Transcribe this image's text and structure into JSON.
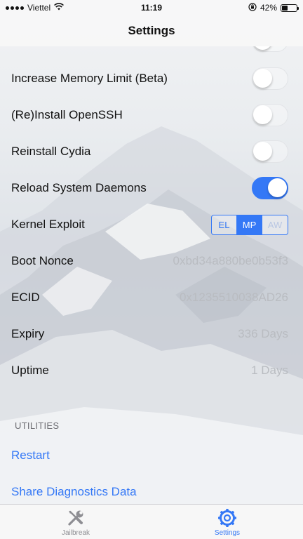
{
  "status_bar": {
    "carrier": "Viettel",
    "time": "11:19",
    "battery_percent": "42%",
    "battery_level": 0.42
  },
  "nav": {
    "title": "Settings"
  },
  "settings": {
    "rows": [
      {
        "label": "Increase Memory Limit (Beta)",
        "type": "toggle",
        "on": false
      },
      {
        "label": "(Re)Install OpenSSH",
        "type": "toggle",
        "on": false
      },
      {
        "label": "Reinstall Cydia",
        "type": "toggle",
        "on": false
      },
      {
        "label": "Reload System Daemons",
        "type": "toggle",
        "on": true
      },
      {
        "label": "Kernel Exploit",
        "type": "segmented",
        "options": [
          "EL",
          "MP",
          "AW"
        ],
        "selected": "MP",
        "disabled": [
          "AW"
        ]
      },
      {
        "label": "Boot Nonce",
        "type": "value",
        "value": "0xbd34a880be0b53f3"
      },
      {
        "label": "ECID",
        "type": "value",
        "value": "0x1235510038AD26"
      },
      {
        "label": "Expiry",
        "type": "value",
        "value": "336 Days"
      },
      {
        "label": "Uptime",
        "type": "value",
        "value": "1 Days"
      }
    ]
  },
  "utilities": {
    "header": "UTILITIES",
    "restart_label": "Restart",
    "share_label": "Share Diagnostics Data"
  },
  "tab_bar": {
    "tabs": [
      {
        "label": "Jailbreak",
        "icon": "wrench-screwdriver-icon",
        "active": false
      },
      {
        "label": "Settings",
        "icon": "gear-icon",
        "active": true
      }
    ]
  },
  "colors": {
    "accent": "#3478f6",
    "value_text": "#b9bcc1",
    "inactive_tab": "#8e8e93"
  }
}
